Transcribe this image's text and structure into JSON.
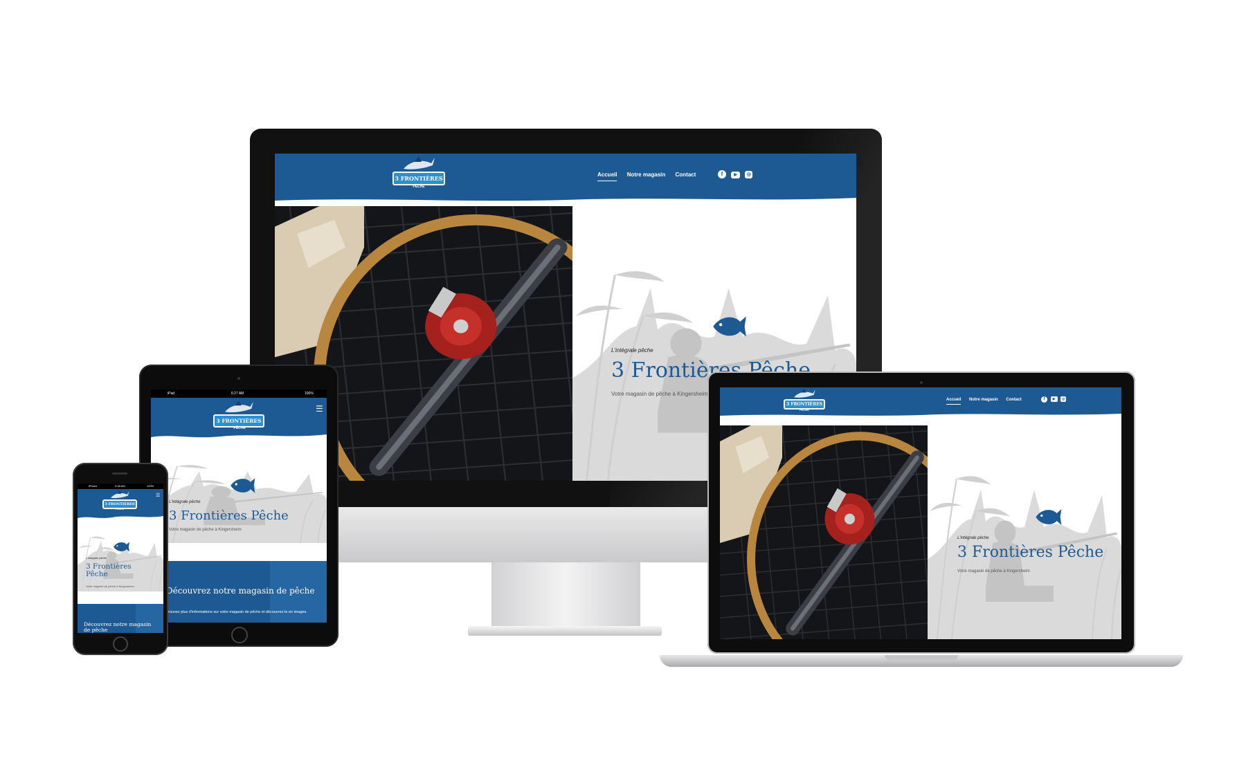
{
  "site": {
    "logo_name": "3 FRONTIÈRES",
    "logo_sub": "PÊCHE",
    "nav": [
      "Accueil",
      "Notre magasin",
      "Contact"
    ],
    "social_icons": [
      "facebook-icon",
      "youtube-icon",
      "instagram-icon"
    ],
    "hero_tag": "L'intégrale pêche",
    "hero_title": "3 Frontières Pêche",
    "hero_subtitle": "Votre magasin de pêche à Kingersheim",
    "section_title": "Découvrez notre magasin de pêche",
    "section_text": "Trouvez plus d'informations sur votre magasin de pêche et découvrez-le en images."
  },
  "tablet_status": {
    "device": "iPad",
    "time": "6:27 AM",
    "battery": "100%"
  },
  "phone_status": {
    "device": "iPhone",
    "time": "3:48 AM",
    "battery": "100%"
  },
  "colors": {
    "brand_blue": "#1d5a94",
    "logo_badge": "#2c8fd1",
    "fish": "#1d5a94"
  }
}
